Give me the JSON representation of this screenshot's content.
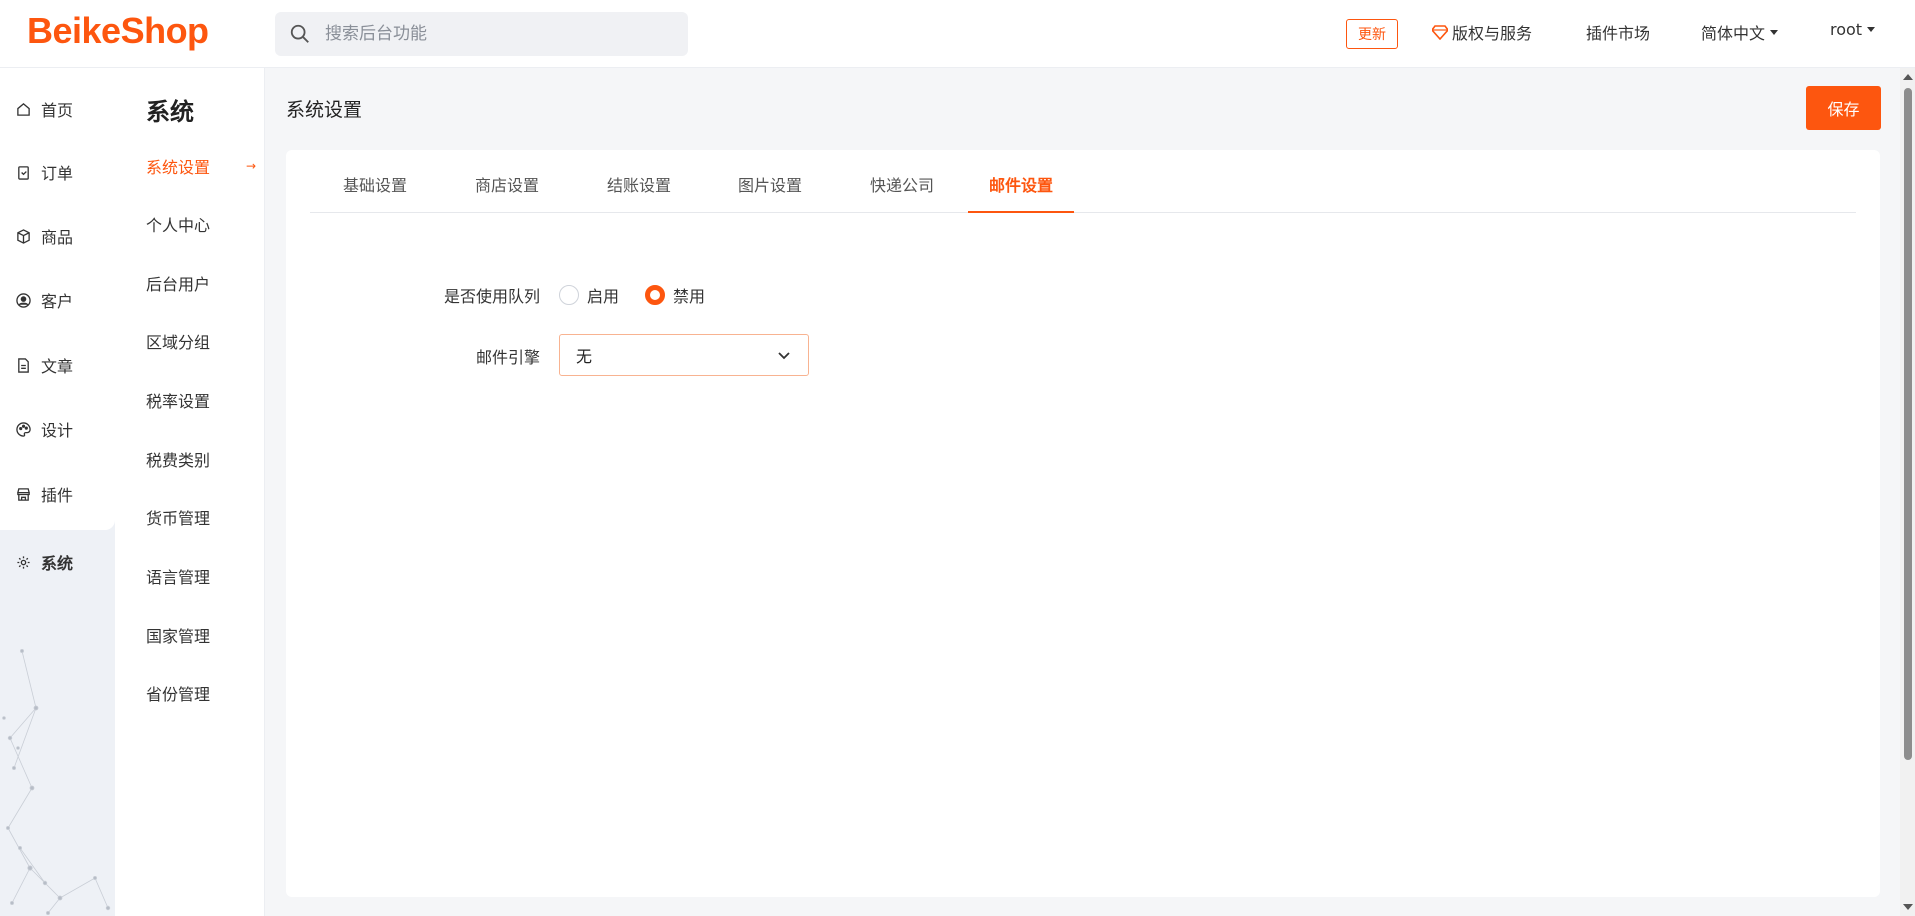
{
  "brand": {
    "logo": "BeikeShop",
    "accent": "#fd560f"
  },
  "header": {
    "search_placeholder": "搜索后台功能",
    "update_label": "更新",
    "copyright_label": "版权与服务",
    "plugin_market_label": "插件市场",
    "language_label": "简体中文",
    "user_label": "root"
  },
  "sidebar": {
    "items": [
      {
        "label": "首页",
        "icon": "home-icon"
      },
      {
        "label": "订单",
        "icon": "clipboard-icon"
      },
      {
        "label": "商品",
        "icon": "box-icon"
      },
      {
        "label": "客户",
        "icon": "user-circle-icon"
      },
      {
        "label": "文章",
        "icon": "document-icon"
      },
      {
        "label": "设计",
        "icon": "palette-icon"
      },
      {
        "label": "插件",
        "icon": "store-icon"
      },
      {
        "label": "系统",
        "icon": "gear-icon",
        "active": true
      }
    ]
  },
  "submenu": {
    "title": "系统",
    "items": [
      {
        "label": "系统设置",
        "active": true
      },
      {
        "label": "个人中心"
      },
      {
        "label": "后台用户"
      },
      {
        "label": "区域分组"
      },
      {
        "label": "税率设置"
      },
      {
        "label": "税费类别"
      },
      {
        "label": "货币管理"
      },
      {
        "label": "语言管理"
      },
      {
        "label": "国家管理"
      },
      {
        "label": "省份管理"
      }
    ]
  },
  "main": {
    "title": "系统设置",
    "save_label": "保存",
    "tabs": [
      {
        "label": "基础设置"
      },
      {
        "label": "商店设置"
      },
      {
        "label": "结账设置"
      },
      {
        "label": "图片设置"
      },
      {
        "label": "快递公司"
      },
      {
        "label": "邮件设置",
        "active": true
      }
    ],
    "form": {
      "queue_label": "是否使用队列",
      "queue_options": [
        "启用",
        "禁用"
      ],
      "queue_selected": "禁用",
      "mail_engine_label": "邮件引擎",
      "mail_engine_value": "无"
    }
  }
}
